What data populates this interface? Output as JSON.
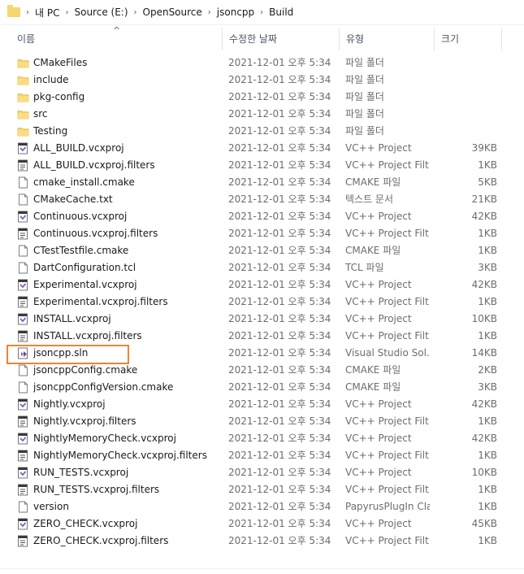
{
  "breadcrumb": [
    "내 PC",
    "Source (E:)",
    "OpenSource",
    "jsoncpp",
    "Build"
  ],
  "columns": {
    "name": "이름",
    "date": "수정한 날짜",
    "type": "유형",
    "size": "크기"
  },
  "sort_arrow": "^",
  "icons": {
    "folder": "folder-icon",
    "vcxproj": "vcxproj-file-icon",
    "filters": "filters-file-icon",
    "generic": "generic-file-icon",
    "sln": "visual-studio-solution-icon"
  },
  "files": [
    {
      "name": "CMakeFiles",
      "date": "2021-12-01 오후 5:34",
      "type": "파일 폴더",
      "size": "",
      "icon": "folder"
    },
    {
      "name": "include",
      "date": "2021-12-01 오후 5:34",
      "type": "파일 폴더",
      "size": "",
      "icon": "folder"
    },
    {
      "name": "pkg-config",
      "date": "2021-12-01 오후 5:34",
      "type": "파일 폴더",
      "size": "",
      "icon": "folder"
    },
    {
      "name": "src",
      "date": "2021-12-01 오후 5:34",
      "type": "파일 폴더",
      "size": "",
      "icon": "folder"
    },
    {
      "name": "Testing",
      "date": "2021-12-01 오후 5:34",
      "type": "파일 폴더",
      "size": "",
      "icon": "folder"
    },
    {
      "name": "ALL_BUILD.vcxproj",
      "date": "2021-12-01 오후 5:34",
      "type": "VC++ Project",
      "size": "39KB",
      "icon": "vcxproj"
    },
    {
      "name": "ALL_BUILD.vcxproj.filters",
      "date": "2021-12-01 오후 5:34",
      "type": "VC++ Project Filt...",
      "size": "1KB",
      "icon": "filters"
    },
    {
      "name": "cmake_install.cmake",
      "date": "2021-12-01 오후 5:34",
      "type": "CMAKE 파일",
      "size": "5KB",
      "icon": "generic"
    },
    {
      "name": "CMakeCache.txt",
      "date": "2021-12-01 오후 5:34",
      "type": "텍스트 문서",
      "size": "21KB",
      "icon": "generic"
    },
    {
      "name": "Continuous.vcxproj",
      "date": "2021-12-01 오후 5:34",
      "type": "VC++ Project",
      "size": "42KB",
      "icon": "vcxproj"
    },
    {
      "name": "Continuous.vcxproj.filters",
      "date": "2021-12-01 오후 5:34",
      "type": "VC++ Project Filt...",
      "size": "1KB",
      "icon": "filters"
    },
    {
      "name": "CTestTestfile.cmake",
      "date": "2021-12-01 오후 5:34",
      "type": "CMAKE 파일",
      "size": "1KB",
      "icon": "generic"
    },
    {
      "name": "DartConfiguration.tcl",
      "date": "2021-12-01 오후 5:34",
      "type": "TCL 파일",
      "size": "3KB",
      "icon": "generic"
    },
    {
      "name": "Experimental.vcxproj",
      "date": "2021-12-01 오후 5:34",
      "type": "VC++ Project",
      "size": "42KB",
      "icon": "vcxproj"
    },
    {
      "name": "Experimental.vcxproj.filters",
      "date": "2021-12-01 오후 5:34",
      "type": "VC++ Project Filt...",
      "size": "1KB",
      "icon": "filters"
    },
    {
      "name": "INSTALL.vcxproj",
      "date": "2021-12-01 오후 5:34",
      "type": "VC++ Project",
      "size": "10KB",
      "icon": "vcxproj"
    },
    {
      "name": "INSTALL.vcxproj.filters",
      "date": "2021-12-01 오후 5:34",
      "type": "VC++ Project Filt...",
      "size": "1KB",
      "icon": "filters"
    },
    {
      "name": "jsoncpp.sln",
      "date": "2021-12-01 오후 5:34",
      "type": "Visual Studio Sol...",
      "size": "14KB",
      "icon": "sln"
    },
    {
      "name": "jsoncppConfig.cmake",
      "date": "2021-12-01 오후 5:34",
      "type": "CMAKE 파일",
      "size": "2KB",
      "icon": "generic"
    },
    {
      "name": "jsoncppConfigVersion.cmake",
      "date": "2021-12-01 오후 5:34",
      "type": "CMAKE 파일",
      "size": "3KB",
      "icon": "generic"
    },
    {
      "name": "Nightly.vcxproj",
      "date": "2021-12-01 오후 5:34",
      "type": "VC++ Project",
      "size": "42KB",
      "icon": "vcxproj"
    },
    {
      "name": "Nightly.vcxproj.filters",
      "date": "2021-12-01 오후 5:34",
      "type": "VC++ Project Filt...",
      "size": "1KB",
      "icon": "filters"
    },
    {
      "name": "NightlyMemoryCheck.vcxproj",
      "date": "2021-12-01 오후 5:34",
      "type": "VC++ Project",
      "size": "42KB",
      "icon": "vcxproj"
    },
    {
      "name": "NightlyMemoryCheck.vcxproj.filters",
      "date": "2021-12-01 오후 5:34",
      "type": "VC++ Project Filt...",
      "size": "1KB",
      "icon": "filters"
    },
    {
      "name": "RUN_TESTS.vcxproj",
      "date": "2021-12-01 오후 5:34",
      "type": "VC++ Project",
      "size": "10KB",
      "icon": "vcxproj"
    },
    {
      "name": "RUN_TESTS.vcxproj.filters",
      "date": "2021-12-01 오후 5:34",
      "type": "VC++ Project Filt...",
      "size": "1KB",
      "icon": "filters"
    },
    {
      "name": "version",
      "date": "2021-12-01 오후 5:34",
      "type": "PapyrusPlugIn Cla...",
      "size": "1KB",
      "icon": "generic"
    },
    {
      "name": "ZERO_CHECK.vcxproj",
      "date": "2021-12-01 오후 5:34",
      "type": "VC++ Project",
      "size": "45KB",
      "icon": "vcxproj"
    },
    {
      "name": "ZERO_CHECK.vcxproj.filters",
      "date": "2021-12-01 오후 5:34",
      "type": "VC++ Project Filt...",
      "size": "1KB",
      "icon": "filters"
    }
  ],
  "colors": {
    "highlight": "#ef8433",
    "folder": "#f7d56f",
    "vs_purple": "#865fc5"
  }
}
